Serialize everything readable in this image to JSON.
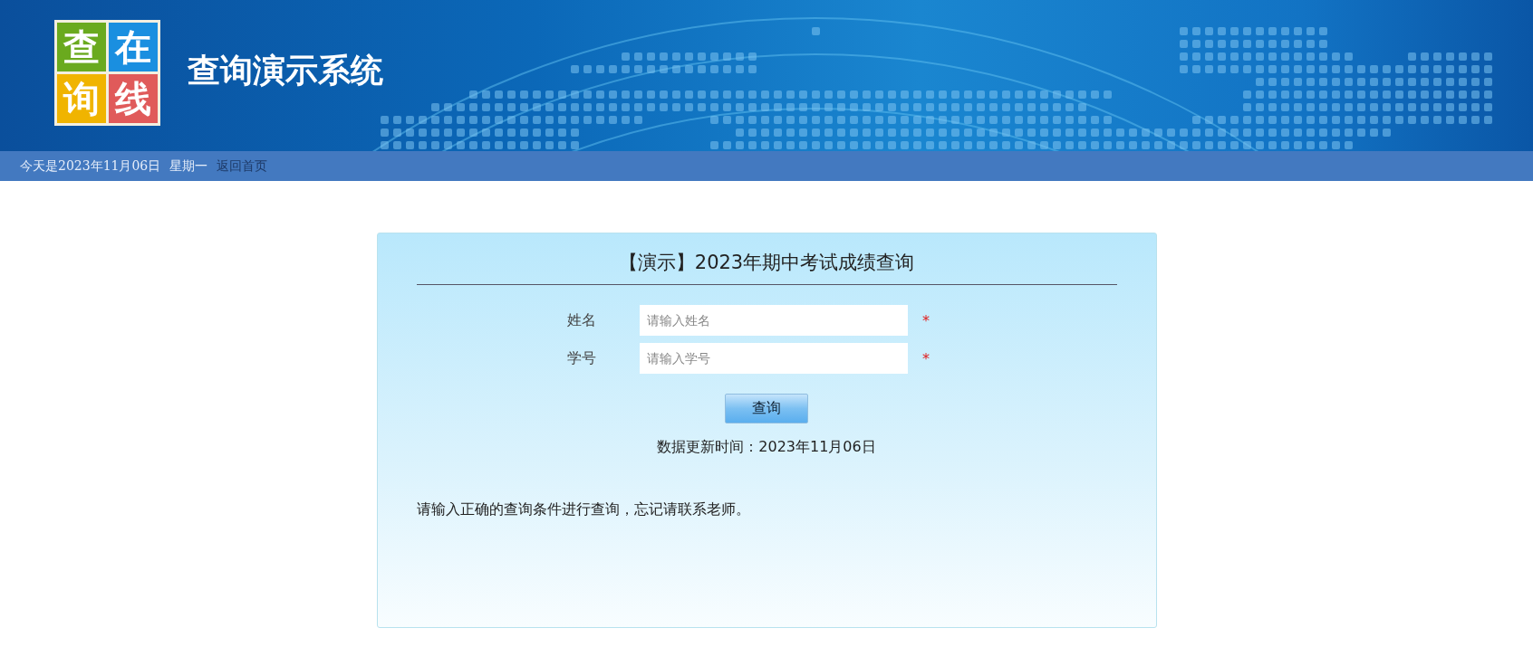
{
  "header": {
    "logo_tiles": [
      {
        "char": "查",
        "color": "#6aaa1e"
      },
      {
        "char": "在",
        "color": "#1a8fe0"
      },
      {
        "char": "询",
        "color": "#f0b400"
      },
      {
        "char": "线",
        "color": "#e05a5a"
      }
    ],
    "title": "查询演示系统"
  },
  "nav_bar": {
    "date": "今天是2023年11月06日",
    "weekday": "星期一",
    "home_link": "返回首页"
  },
  "query_card": {
    "title": "【演示】2023年期中考试成绩查询",
    "fields": [
      {
        "label": "姓名",
        "placeholder": "请输入姓名",
        "required_mark": "*"
      },
      {
        "label": "学号",
        "placeholder": "请输入学号",
        "required_mark": "*"
      }
    ],
    "submit_button": "查询",
    "update_time": "数据更新时间：2023年11月06日",
    "note": "请输入正确的查询条件进行查询，忘记请联系老师。"
  }
}
